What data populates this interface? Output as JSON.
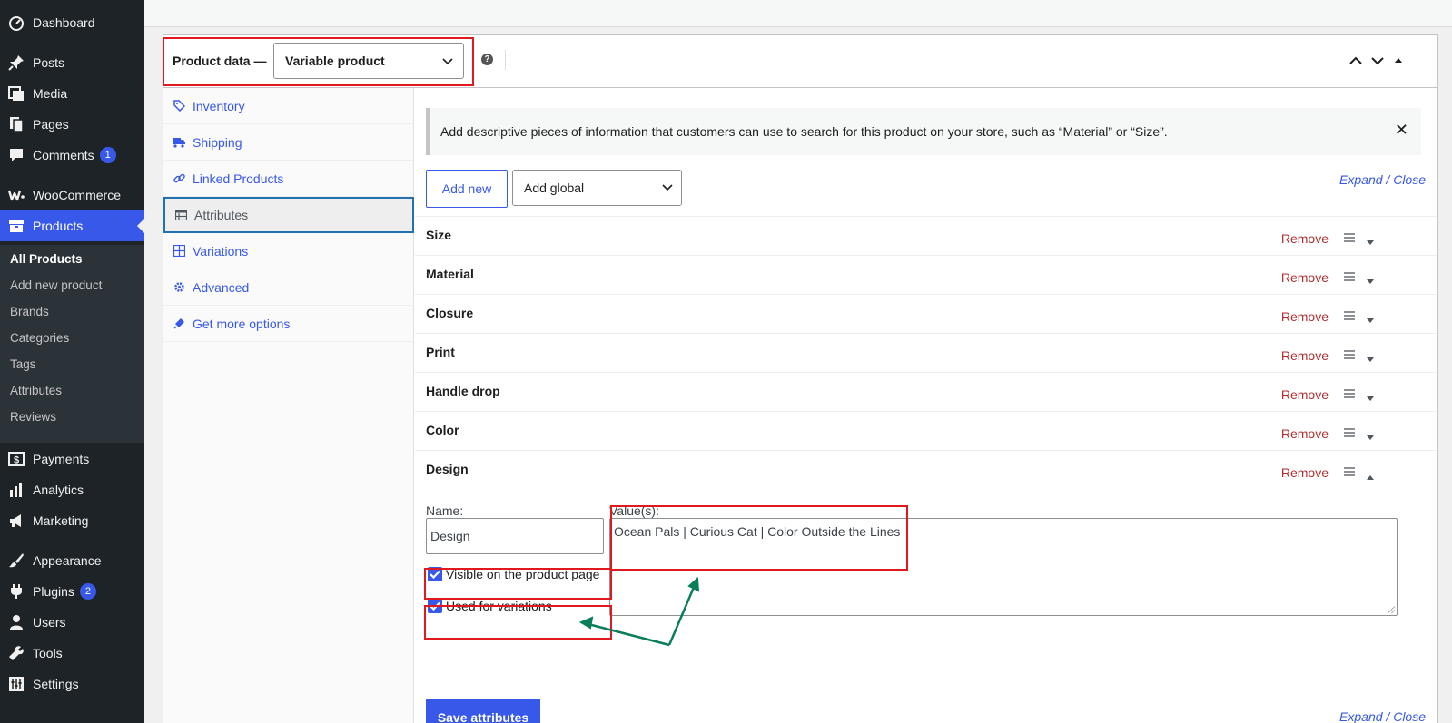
{
  "sidebar": {
    "items": [
      {
        "label": "Dashboard",
        "icon": "dashboard-icon"
      },
      {
        "label": "Posts",
        "icon": "pin-icon"
      },
      {
        "label": "Media",
        "icon": "media-icon"
      },
      {
        "label": "Pages",
        "icon": "pages-icon"
      },
      {
        "label": "Comments",
        "icon": "comment-icon",
        "badge": "1"
      },
      {
        "label": "WooCommerce",
        "icon": "woo-icon"
      },
      {
        "label": "Products",
        "icon": "archive-icon"
      },
      {
        "label": "Payments",
        "icon": "dollar-icon"
      },
      {
        "label": "Analytics",
        "icon": "bar-chart-icon"
      },
      {
        "label": "Marketing",
        "icon": "megaphone-icon"
      },
      {
        "label": "Appearance",
        "icon": "brush-icon"
      },
      {
        "label": "Plugins",
        "icon": "plug-icon",
        "badge": "2"
      },
      {
        "label": "Users",
        "icon": "user-icon"
      },
      {
        "label": "Tools",
        "icon": "wrench-icon"
      },
      {
        "label": "Settings",
        "icon": "settings-icon"
      }
    ],
    "submenu": [
      "All Products",
      "Add new product",
      "Brands",
      "Categories",
      "Tags",
      "Attributes",
      "Reviews"
    ],
    "active_item": "Products",
    "current_submenu": "All Products"
  },
  "product_data": {
    "label": "Product data —",
    "type_value": "Variable product"
  },
  "tabs": [
    {
      "label": "Inventory",
      "icon": "tag-icon"
    },
    {
      "label": "Shipping",
      "icon": "truck-icon"
    },
    {
      "label": "Linked Products",
      "icon": "link-icon"
    },
    {
      "label": "Attributes",
      "icon": "table-icon"
    },
    {
      "label": "Variations",
      "icon": "grid-icon"
    },
    {
      "label": "Advanced",
      "icon": "gear-icon"
    },
    {
      "label": "Get more options",
      "icon": "plugin-icon"
    }
  ],
  "active_tab": "Attributes",
  "attributes": {
    "notice": "Add descriptive pieces of information that customers can use to search for this product on your store, such as “Material” or “Size”.",
    "add_new_label": "Add new",
    "add_global_label": "Add global",
    "expand_label": "Expand",
    "separator": "/",
    "close_label": "Close",
    "remove_label": "Remove",
    "rows": [
      "Size",
      "Material",
      "Closure",
      "Print",
      "Handle drop",
      "Color",
      "Design"
    ],
    "expanded": {
      "name_label": "Name:",
      "name_value": "Design",
      "values_label": "Value(s):",
      "values_value": "Ocean Pals | Curious Cat | Color Outside the Lines",
      "visible_label": "Visible on the product page",
      "visible_checked": true,
      "variations_label": "Used for variations",
      "variations_checked": true
    },
    "save_label": "Save attributes"
  },
  "colors": {
    "accent": "#3858e9",
    "sidebar_bg": "#1d2327",
    "remove": "#b32d2e",
    "highlight": "#e0191f",
    "arrow": "#0a7d5a"
  }
}
